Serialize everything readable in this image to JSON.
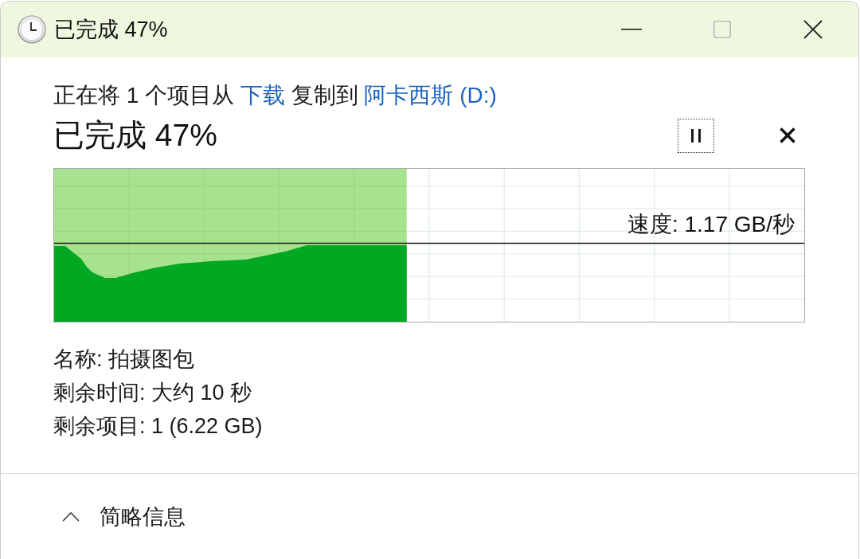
{
  "window": {
    "title": "已完成 47%",
    "controls": [
      {
        "kind": "minimize",
        "disabled": false
      },
      {
        "kind": "maximize",
        "disabled": true
      },
      {
        "kind": "close",
        "disabled": false
      }
    ]
  },
  "operation": [
    {
      "kind": "text",
      "text": "正在将 1 个项目从"
    },
    {
      "kind": "link",
      "text": "下载"
    },
    {
      "kind": "text",
      "text": "复制到"
    },
    {
      "kind": "link",
      "text": "阿卡西斯 (D:)"
    }
  ],
  "status": {
    "text": "已完成 47%",
    "buttons": [
      {
        "kind": "pause",
        "focused": true
      },
      {
        "kind": "cancel",
        "focused": false
      }
    ]
  },
  "progress": {
    "level": 0.47,
    "speed": "速度: 1.17 GB/秒"
  },
  "details": [
    {
      "label": "名称:",
      "value": "拍摄图包"
    },
    {
      "label": "剩余时间:",
      "value": "大约 10 秒"
    },
    {
      "label": "剩余项目:",
      "value": "1 (6.22 GB)"
    }
  ],
  "footer": {
    "label": "简略信息",
    "expanded": true
  }
}
